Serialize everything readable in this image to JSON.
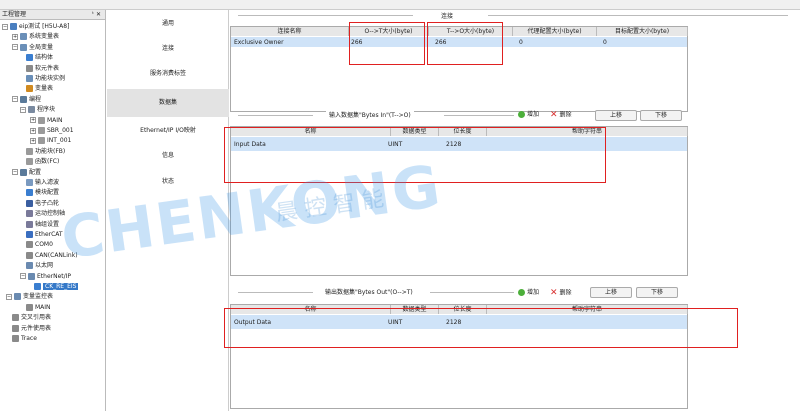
{
  "toolbar": {
    "left_text": "..",
    "right_text": ".."
  },
  "tree": {
    "title": "工程管理",
    "pin": "ᵗ ✕",
    "rows": [
      {
        "label": "eip测试 [H5U-A8]",
        "indent": 0,
        "exp": "−",
        "icon": "computer-icon",
        "color": "#4a7fc0"
      },
      {
        "label": "系统变量表",
        "indent": 10,
        "exp": "+",
        "icon": "table-icon",
        "color": "#6a8fb8"
      },
      {
        "label": "全局变量",
        "indent": 10,
        "exp": "−",
        "icon": "table-icon",
        "color": "#6a8fb8"
      },
      {
        "label": "结构体",
        "indent": 24,
        "exp": "",
        "icon": "struct-icon",
        "color": "#3a7ed0"
      },
      {
        "label": "软元件表",
        "indent": 24,
        "exp": "",
        "icon": "table-icon",
        "color": "#8a8a8a"
      },
      {
        "label": "功能块实例",
        "indent": 24,
        "exp": "",
        "icon": "fb-icon",
        "color": "#6a8fb8"
      },
      {
        "label": "变量表",
        "indent": 24,
        "exp": "",
        "icon": "var-icon",
        "color": "#d08a20"
      },
      {
        "label": "编程",
        "indent": 10,
        "exp": "−",
        "icon": "program-icon",
        "color": "#5a7a9a"
      },
      {
        "label": "程序块",
        "indent": 18,
        "exp": "−",
        "icon": "folder-icon",
        "color": "#7a8aa0"
      },
      {
        "label": "MAIN",
        "indent": 28,
        "exp": "+",
        "icon": "pou-icon",
        "color": "#9a9a9a"
      },
      {
        "label": "SBR_001",
        "indent": 28,
        "exp": "+",
        "icon": "pou-icon",
        "color": "#9a9a9a"
      },
      {
        "label": "INT_001",
        "indent": 28,
        "exp": "+",
        "icon": "pou-icon",
        "color": "#9a9a9a"
      },
      {
        "label": "功能块(FB)",
        "indent": 24,
        "exp": "",
        "icon": "fb-icon",
        "color": "#9a9a9a"
      },
      {
        "label": "函数(FC)",
        "indent": 24,
        "exp": "",
        "icon": "fc-icon",
        "color": "#9a9a9a"
      },
      {
        "label": "配置",
        "indent": 10,
        "exp": "−",
        "icon": "config-icon",
        "color": "#5a7a9a"
      },
      {
        "label": "输入滤波",
        "indent": 24,
        "exp": "",
        "icon": "filter-icon",
        "color": "#7a9ac0"
      },
      {
        "label": "模块配置",
        "indent": 24,
        "exp": "",
        "icon": "module-icon",
        "color": "#3a7ed0"
      },
      {
        "label": "电子凸轮",
        "indent": 24,
        "exp": "",
        "icon": "cam-icon",
        "color": "#3a5ea0"
      },
      {
        "label": "运动控制轴",
        "indent": 24,
        "exp": "",
        "icon": "axis-icon",
        "color": "#7a7a9a"
      },
      {
        "label": "轴组设置",
        "indent": 24,
        "exp": "",
        "icon": "axisgroup-icon",
        "color": "#7a7a9a"
      },
      {
        "label": "EtherCAT",
        "indent": 24,
        "exp": "",
        "icon": "ethercat-icon",
        "color": "#3a6ec0"
      },
      {
        "label": "COM0",
        "indent": 24,
        "exp": "",
        "icon": "com-icon",
        "color": "#8a8a8a"
      },
      {
        "label": "CAN(CANLink)",
        "indent": 24,
        "exp": "",
        "icon": "can-icon",
        "color": "#8a8a8a"
      },
      {
        "label": "以太网",
        "indent": 24,
        "exp": "",
        "icon": "ethernet-icon",
        "color": "#6a8ab0"
      },
      {
        "label": "EtherNet/IP",
        "indent": 18,
        "exp": "−",
        "icon": "eip-icon",
        "color": "#6a8ab0"
      },
      {
        "label": "CK_RE_EIS",
        "indent": 32,
        "exp": "",
        "icon": "device-icon",
        "color": "#3a7ed0",
        "selected": true
      },
      {
        "label": "变量监控表",
        "indent": 4,
        "exp": "−",
        "icon": "monitor-icon",
        "color": "#6a8ab0"
      },
      {
        "label": "MAIN",
        "indent": 24,
        "exp": "",
        "icon": "table-icon",
        "color": "#8a8a8a"
      },
      {
        "label": "交叉引用表",
        "indent": 10,
        "exp": "",
        "icon": "xref-icon",
        "color": "#8a8a8a"
      },
      {
        "label": "元件使用表",
        "indent": 10,
        "exp": "",
        "icon": "usage-icon",
        "color": "#8a8a8a"
      },
      {
        "label": "Trace",
        "indent": 10,
        "exp": "",
        "icon": "trace-icon",
        "color": "#8a8a8a"
      }
    ]
  },
  "nav": {
    "items": [
      {
        "label": "通用",
        "active": false
      },
      {
        "label": "连接",
        "active": false
      },
      {
        "label": "服务消费标签",
        "active": false
      },
      {
        "label": "数据集",
        "active": true
      },
      {
        "label": "Ethernet/IP I/O映射",
        "active": false
      },
      {
        "label": "信息",
        "active": false
      },
      {
        "label": "状态",
        "active": false
      }
    ]
  },
  "connection": {
    "group_title": "连接",
    "headers": [
      "连接名称",
      "O-->T大小(byte)",
      "T-->O大小(byte)",
      "代理配置大小(byte)",
      "目标配置大小(byte)"
    ],
    "rows": [
      [
        "Exclusive Owner",
        "266",
        "266",
        "0",
        "0"
      ]
    ]
  },
  "input": {
    "group_title": "输入数据集\"Bytes In\"(T-->O)",
    "add_label": "增加",
    "delete_label": "删除",
    "up_label": "上移",
    "down_label": "下移",
    "headers": [
      "名称",
      "数据类型",
      "位长度",
      "帮助字符串"
    ],
    "rows": [
      [
        "Input Data",
        "UINT",
        "2128",
        ""
      ]
    ]
  },
  "output": {
    "group_title": "输出数据集\"Bytes Out\"(O-->T)",
    "add_label": "增加",
    "delete_label": "删除",
    "up_label": "上移",
    "down_label": "下移",
    "headers": [
      "名称",
      "数据类型",
      "位长度",
      "帮助字符串"
    ],
    "rows": [
      [
        "Output Data",
        "UINT",
        "2128",
        ""
      ]
    ]
  },
  "watermark": {
    "text": "CHENKONG",
    "cn": "晨 控 智 能"
  },
  "colors": {
    "accent": "#3478c8",
    "highlight": "#e02020",
    "selected_row": "#cfe3f8",
    "add": "#4caf3a",
    "delete": "#d83030"
  }
}
